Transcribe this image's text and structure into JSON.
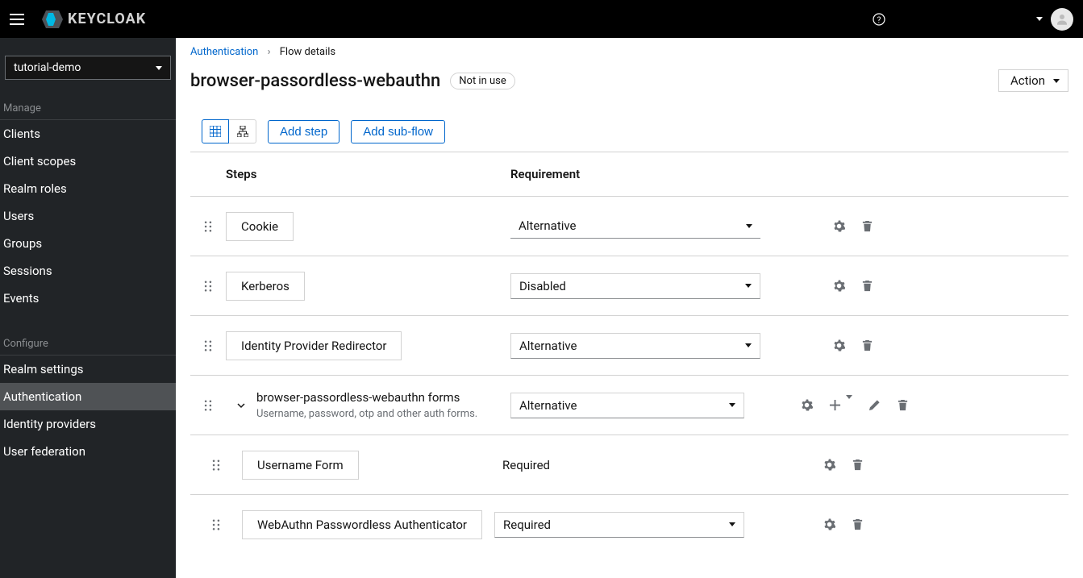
{
  "header": {
    "logo_text": "KEYCLOAK"
  },
  "sidebar": {
    "realm": "tutorial-demo",
    "group_manage": "Manage",
    "group_configure": "Configure",
    "items_manage": [
      "Clients",
      "Client scopes",
      "Realm roles",
      "Users",
      "Groups",
      "Sessions",
      "Events"
    ],
    "items_configure": [
      "Realm settings",
      "Authentication",
      "Identity providers",
      "User federation"
    ],
    "active": "Authentication"
  },
  "breadcrumb": {
    "root": "Authentication",
    "current": "Flow details"
  },
  "title": {
    "name": "browser-passordless-webauthn",
    "badge": "Not in use",
    "action_label": "Action"
  },
  "toolbar": {
    "add_step": "Add step",
    "add_subflow": "Add sub-flow"
  },
  "columns": {
    "steps": "Steps",
    "requirement": "Requirement"
  },
  "rows": [
    {
      "type": "exec",
      "label": "Cookie",
      "requirement": "Alternative",
      "req_mode": "select-underline"
    },
    {
      "type": "exec",
      "label": "Kerberos",
      "requirement": "Disabled",
      "req_mode": "select-outline"
    },
    {
      "type": "exec",
      "label": "Identity Provider Redirector",
      "requirement": "Alternative",
      "req_mode": "select-outline"
    },
    {
      "type": "subflow",
      "label": "browser-passordless-webauthn forms",
      "desc": "Username, password, otp and other auth forms.",
      "requirement": "Alternative",
      "req_mode": "select-outline"
    },
    {
      "type": "child-exec",
      "label": "Username Form",
      "requirement": "Required",
      "req_mode": "static"
    },
    {
      "type": "child-exec",
      "label": "WebAuthn Passwordless Authenticator",
      "requirement": "Required",
      "req_mode": "select-outline"
    }
  ]
}
